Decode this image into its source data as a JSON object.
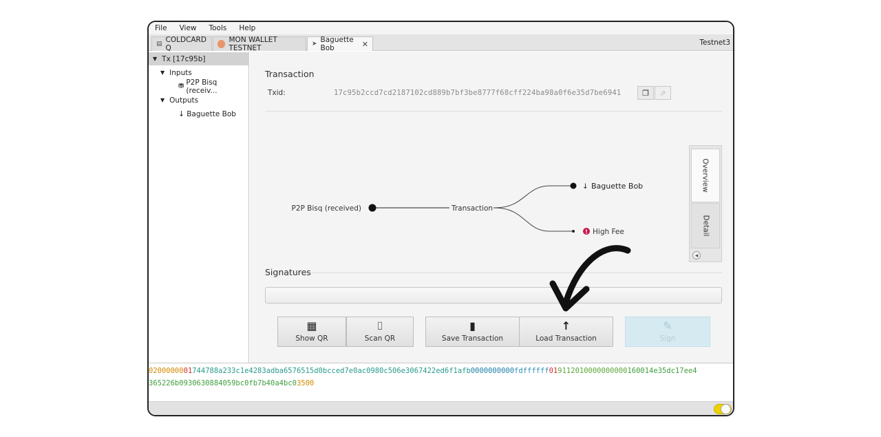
{
  "menu": [
    "File",
    "View",
    "Tools",
    "Help"
  ],
  "tabs": [
    {
      "label": "COLDCARD Q",
      "icon": "wallet-icon"
    },
    {
      "label": "MON WALLET TESTNET",
      "icon": "wallet-avatar-icon"
    },
    {
      "label": "Baguette Bob",
      "icon": "send-icon",
      "active": true
    }
  ],
  "network": "Testnet3",
  "tree": {
    "root": "Tx [17c95b]",
    "inputs_label": "Inputs",
    "input_item": "P2P Bisq (receiv...",
    "outputs_label": "Outputs",
    "output_item": "Baguette Bob"
  },
  "transaction": {
    "title": "Transaction",
    "txid_label": "Txid:",
    "txid": "17c95b2ccd7cd2187102cd889b7bf3be8777f68cff224ba98a0f6e35d7be6941"
  },
  "diagram": {
    "input": "P2P Bisq (received)",
    "center": "Transaction",
    "output": "Baguette Bob",
    "fee": "High Fee"
  },
  "side_tabs": [
    "Overview",
    "Detail"
  ],
  "signatures": {
    "title": "Signatures"
  },
  "buttons": {
    "show_qr": "Show QR",
    "scan_qr": "Scan QR",
    "save": "Save Transaction",
    "load": "Load Transaction",
    "sign": "Sign"
  },
  "hex": {
    "line1": [
      {
        "t": "02000000",
        "c": "#d48a00"
      },
      {
        "t": "01",
        "c": "#d0302f"
      },
      {
        "t": "744788a233c1e4283adba6576515d0bcced7e0ac0980c506e3067422ed6f1afb",
        "c": "#2a9a8c"
      },
      {
        "t": "00000000",
        "c": "#1f7fa8"
      },
      {
        "t": "00",
        "c": "#1f7fa8"
      },
      {
        "t": "fdffffff",
        "c": "#2a8fb8"
      },
      {
        "t": "01",
        "c": "#d0302f"
      },
      {
        "t": "9112010000000000",
        "c": "#5aa83a"
      },
      {
        "t": "160014e35dc17ee4",
        "c": "#3f9e3f"
      }
    ],
    "line2": [
      {
        "t": "365226b0930630884059bc0fb7b40a4bc0",
        "c": "#3f9e3f"
      },
      {
        "t": "3500",
        "c": "#d48a00"
      }
    ]
  },
  "colors": {
    "accent_toggle": "#f0d000",
    "fee_warning": "#c8194a",
    "sign_disabled": "#d6eaf2"
  }
}
